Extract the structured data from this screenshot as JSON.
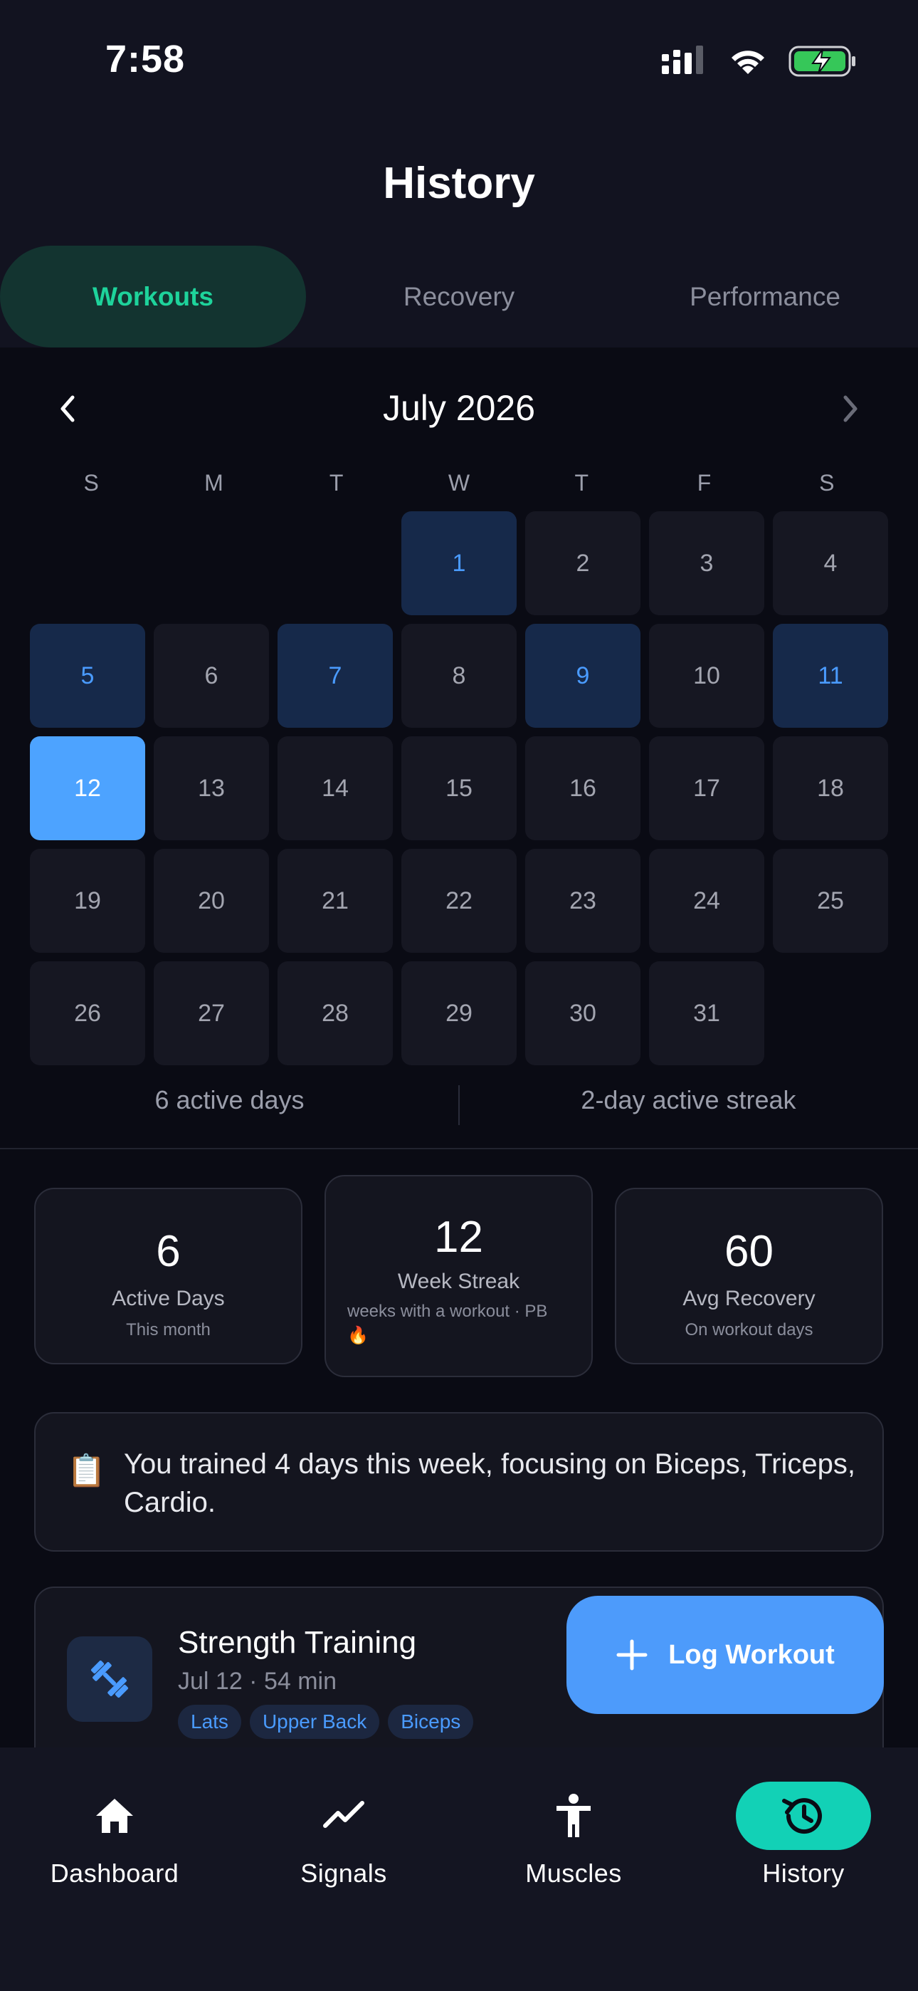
{
  "status_bar": {
    "time": "7:58"
  },
  "page": {
    "title": "History"
  },
  "tabs": [
    {
      "label": "Workouts",
      "active": true
    },
    {
      "label": "Recovery",
      "active": false
    },
    {
      "label": "Performance",
      "active": false
    }
  ],
  "calendar": {
    "month_label": "July 2026",
    "weekdays": [
      "S",
      "M",
      "T",
      "W",
      "T",
      "F",
      "S"
    ],
    "leading_blanks": 3,
    "days": [
      "1",
      "2",
      "3",
      "4",
      "5",
      "6",
      "7",
      "8",
      "9",
      "10",
      "11",
      "12",
      "13",
      "14",
      "15",
      "16",
      "17",
      "18",
      "19",
      "20",
      "21",
      "22",
      "23",
      "24",
      "25",
      "26",
      "27",
      "28",
      "29",
      "30",
      "31"
    ],
    "active_days": [
      "1",
      "5",
      "7",
      "9",
      "11"
    ],
    "today": "12",
    "summary_left": "6 active days",
    "summary_right": "2-day active streak"
  },
  "stats": {
    "active_days": {
      "value": "6",
      "label": "Active Days",
      "sub": "This month"
    },
    "week_streak": {
      "value": "12",
      "label": "Week Streak",
      "sub": "weeks with a workout · PB 🔥"
    },
    "avg_recovery": {
      "value": "60",
      "label": "Avg Recovery",
      "sub": "On workout days"
    }
  },
  "insight": {
    "icon": "📋",
    "text": "You trained 4 days this week, focusing on Biceps, Triceps, Cardio."
  },
  "workout": {
    "title": "Strength Training",
    "meta": "Jul 12 · 54 min",
    "tags": [
      "Lats",
      "Upper Back",
      "Biceps"
    ]
  },
  "fab": {
    "label": "Log Workout"
  },
  "nav": [
    {
      "label": "Dashboard",
      "icon": "home-icon",
      "active": false
    },
    {
      "label": "Signals",
      "icon": "trend-icon",
      "active": false
    },
    {
      "label": "Muscles",
      "icon": "person-icon",
      "active": false
    },
    {
      "label": "History",
      "icon": "history-icon",
      "active": true
    }
  ],
  "colors": {
    "accent_green": "#1ed39b",
    "accent_blue": "#4da3ff",
    "nav_active": "#12d1b6"
  }
}
